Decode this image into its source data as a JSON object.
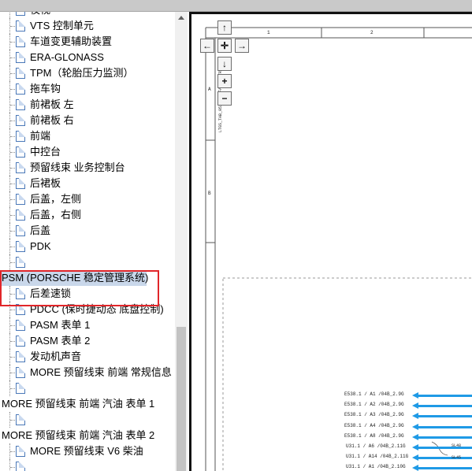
{
  "tree": {
    "items": [
      {
        "label": "夜视",
        "level": 1
      },
      {
        "label": "VTS 控制单元",
        "level": 1
      },
      {
        "label": "车道变更辅助装置",
        "level": 1
      },
      {
        "label": "ERA-GLONASS",
        "level": 1
      },
      {
        "label": "TPM（轮胎压力监测）",
        "level": 1
      },
      {
        "label": "拖车钩",
        "level": 1
      },
      {
        "label": "前裙板 左",
        "level": 1
      },
      {
        "label": "前裙板 右",
        "level": 1
      },
      {
        "label": "前端",
        "level": 1
      },
      {
        "label": "中控台",
        "level": 1
      },
      {
        "label": "预留线束 业务控制台",
        "level": 1
      },
      {
        "label": "后裙板",
        "level": 1
      },
      {
        "label": "后盖，左侧",
        "level": 1
      },
      {
        "label": "后盖，右侧",
        "level": 1
      },
      {
        "label": "后盖",
        "level": 1
      },
      {
        "label": "PDK",
        "level": 1
      },
      {
        "label": "",
        "level": 1
      },
      {
        "label": "PSM (PORSCHE 稳定管理系统)",
        "level": 0,
        "selected": true
      },
      {
        "label": "后差速锁",
        "level": 1
      },
      {
        "label": "PDCC (保时捷动态 底盘控制)",
        "level": 1
      },
      {
        "label": "PASM 表单 1",
        "level": 1
      },
      {
        "label": "PASM 表单 2",
        "level": 1
      },
      {
        "label": "发动机声音",
        "level": 1
      },
      {
        "label": "MORE 预留线束 前端 常规信息",
        "level": 1
      },
      {
        "label": "",
        "level": 1
      },
      {
        "label": "MORE 预留线束 前端 汽油 表单 1",
        "level": 0
      },
      {
        "label": "",
        "level": 1
      },
      {
        "label": "MORE 预留线束 前端 汽油 表单 2",
        "level": 0
      },
      {
        "label": "MORE 预留线束 V6 柴油",
        "level": 1
      },
      {
        "label": "",
        "level": 1
      }
    ]
  },
  "viewer": {
    "nav": {
      "up": "↑",
      "left": "←",
      "center": "✛",
      "right": "→",
      "down": "↓",
      "zoom_in": "+",
      "zoom_out": "−"
    },
    "ruler_cols": [
      "1",
      "2"
    ],
    "ruler_rows": [
      "A",
      "B"
    ],
    "vertical_code": "LTGS_TAB_052_277_FAHRGASTRAUM",
    "wires": [
      {
        "label": "E538.1 / A1  /04B_2.9G"
      },
      {
        "label": "E538.1 / A2  /04B_2.9G"
      },
      {
        "label": "E538.1 / A3  /04B_2.9G"
      },
      {
        "label": "E538.1 / A4  /04B_2.9G"
      },
      {
        "label": "E538.1 / A8  /04B_2.9G"
      },
      {
        "label": "U31.1 / A6  /04B_2.11G"
      },
      {
        "label": "U31.1 / A14 /04B_2.11G"
      },
      {
        "label": "U31.1 / A1  /04B_2.10G"
      }
    ],
    "small_labels": [
      "SL48",
      "SL45"
    ]
  },
  "colors": {
    "wire": "#1f9ae6",
    "highlight": "#e1262a",
    "selection": "#c9d7ea"
  }
}
